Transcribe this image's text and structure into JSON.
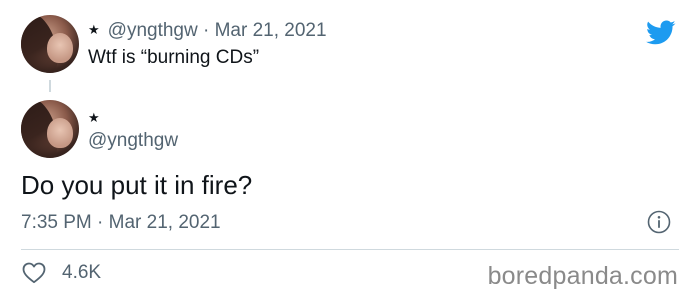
{
  "reply_to": {
    "star": "★",
    "meta": "@yngthgw · Mar 21, 2021",
    "text": "Wtf is “burning CDs”"
  },
  "tweet": {
    "star": "★",
    "handle": "@yngthgw",
    "text": "Do you put it in fire?",
    "timestamp": "7:35 PM · Mar 21, 2021"
  },
  "engagement": {
    "likes": "4.6K"
  },
  "watermark": "boredpanda.com",
  "icons": {
    "brand": "twitter-bird-icon",
    "info": "info-icon",
    "like": "heart-icon"
  },
  "colors": {
    "twitter_blue": "#1d9bf0",
    "text_primary": "#0f1419",
    "text_secondary": "#536471",
    "divider": "#cfd9de"
  }
}
